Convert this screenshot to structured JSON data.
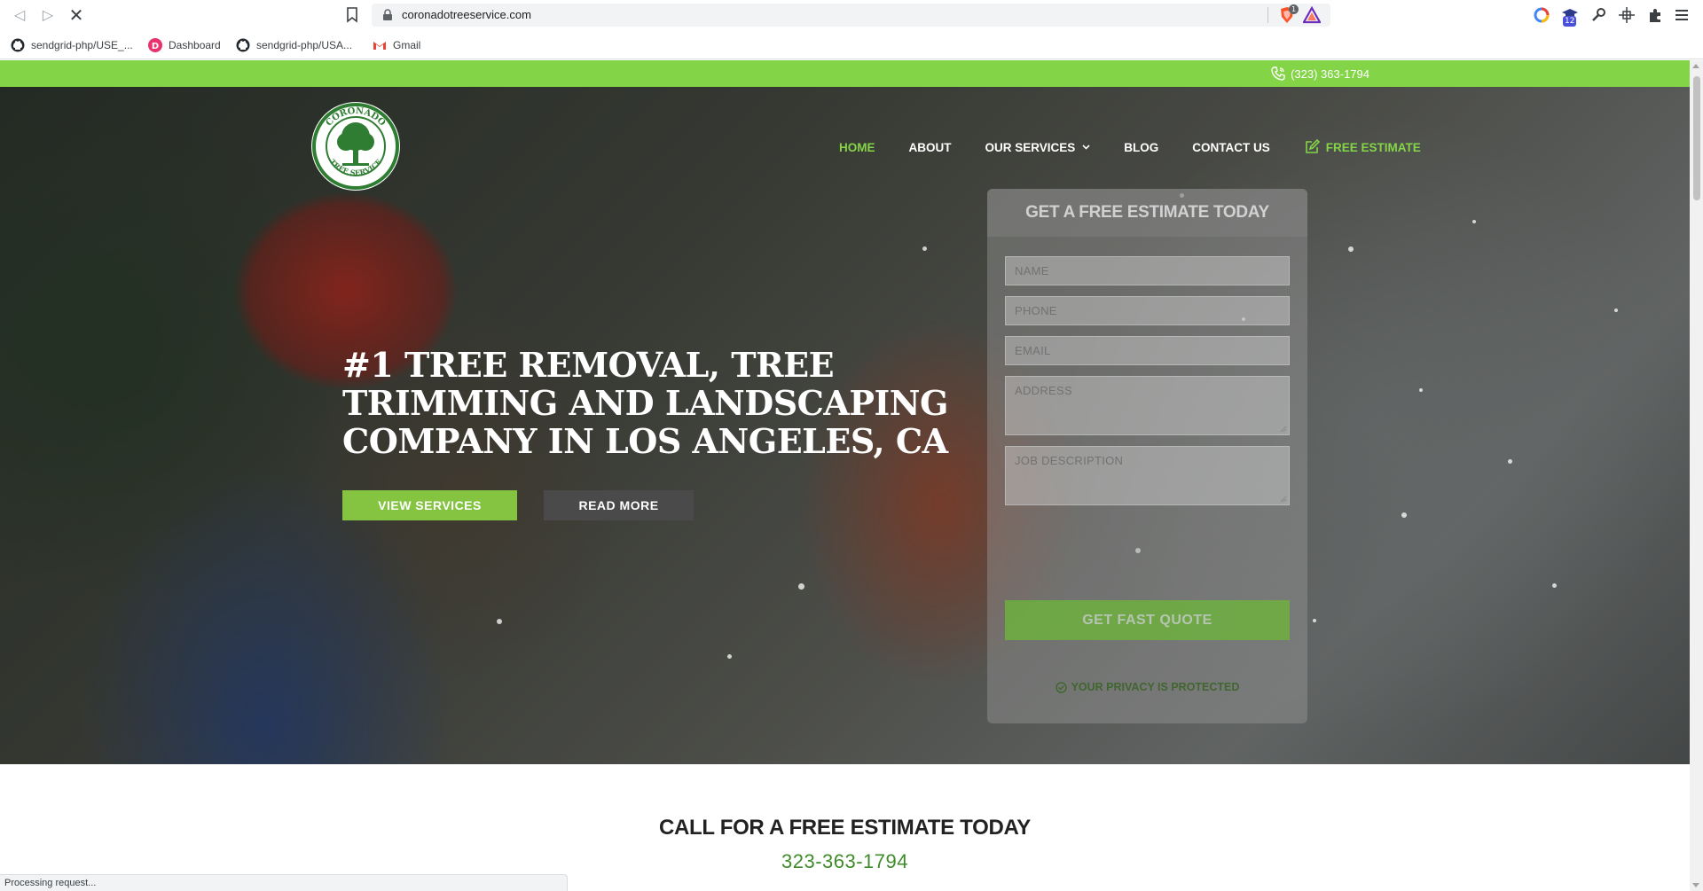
{
  "browser": {
    "url": "coronadotreeservice.com",
    "brave_shield_count": "1",
    "extension_badge": "12",
    "bookmarks": [
      {
        "label": "sendgrid-php/USE_...",
        "icon": "github-icon"
      },
      {
        "label": "Dashboard",
        "icon": "dashboard-icon"
      },
      {
        "label": "sendgrid-php/USA...",
        "icon": "github-icon"
      },
      {
        "label": "Gmail",
        "icon": "gmail-icon"
      }
    ],
    "status_text": "Processing request..."
  },
  "topbar": {
    "phone": "(323) 363-1794",
    "icon": "phone-icon",
    "color": "#84d448"
  },
  "logo": {
    "top_text": "CORONADO",
    "bottom_text": "TREE SERVICE"
  },
  "nav": {
    "items": [
      {
        "label": "HOME",
        "active": true
      },
      {
        "label": "ABOUT"
      },
      {
        "label": "OUR SERVICES",
        "has_dropdown": true
      },
      {
        "label": "BLOG"
      },
      {
        "label": "CONTACT US"
      },
      {
        "label": "FREE ESTIMATE",
        "icon": "edit-icon"
      }
    ]
  },
  "hero": {
    "headline": [
      "#1 TREE REMOVAL, TREE",
      "TRIMMING AND LANDSCAPING",
      "COMPANY IN LOS ANGELES, CA"
    ],
    "primary_button": "VIEW SERVICES",
    "secondary_button": "READ MORE"
  },
  "form": {
    "title": "GET A FREE ESTIMATE TODAY",
    "fields": {
      "name": "NAME",
      "phone": "PHONE",
      "email": "EMAIL",
      "address": "ADDRESS",
      "job_description": "JOB DESCRIPTION"
    },
    "submit": "GET FAST QUOTE",
    "privacy": "YOUR PRIVACY IS PROTECTED"
  },
  "cta": {
    "title": "CALL FOR A FREE ESTIMATE TODAY",
    "phone": "323-363-1794"
  },
  "colors": {
    "accent_green": "#84d448",
    "button_green": "#84c441",
    "phone_green": "#3f8b2a",
    "dark_button": "#4a4a4a"
  }
}
